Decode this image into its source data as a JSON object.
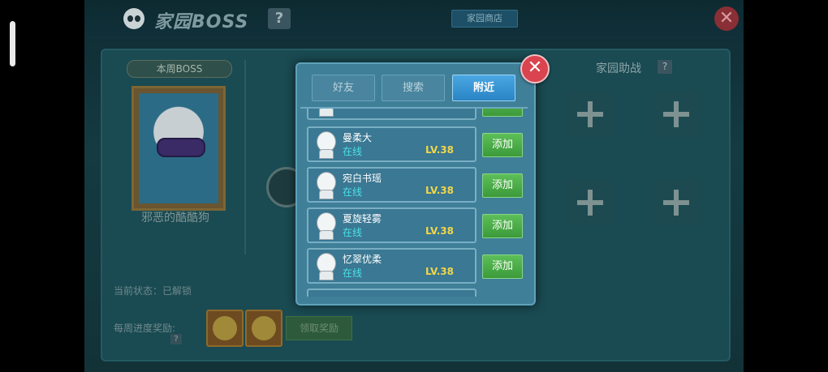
{
  "header": {
    "title": "家园BOSS",
    "help_label": "?",
    "shop_label": "家园商店",
    "close_label": "✕"
  },
  "boss_panel": {
    "week_label": "本周BOSS",
    "boss_name": "邪恶的酷酷狗",
    "status_text": "当前状态：已解锁",
    "reward_label": "每周进度奖励:",
    "reward_help": "?",
    "claim_label": "领取奖励"
  },
  "helpers": {
    "title": "家园助战",
    "help_label": "?"
  },
  "modal": {
    "close_label": "✕",
    "tabs": [
      {
        "label": "好友",
        "active": false
      },
      {
        "label": "搜索",
        "active": false
      },
      {
        "label": "附近",
        "active": true
      }
    ],
    "players": [
      {
        "name": "曼柔大",
        "status": "在线",
        "level": "LV.38",
        "action": "添加"
      },
      {
        "name": "宛白书瑶",
        "status": "在线",
        "level": "LV.38",
        "action": "添加"
      },
      {
        "name": "夏旋轻雾",
        "status": "在线",
        "level": "LV.38",
        "action": "添加"
      },
      {
        "name": "忆翠优柔",
        "status": "在线",
        "level": "LV.38",
        "action": "添加"
      }
    ]
  }
}
